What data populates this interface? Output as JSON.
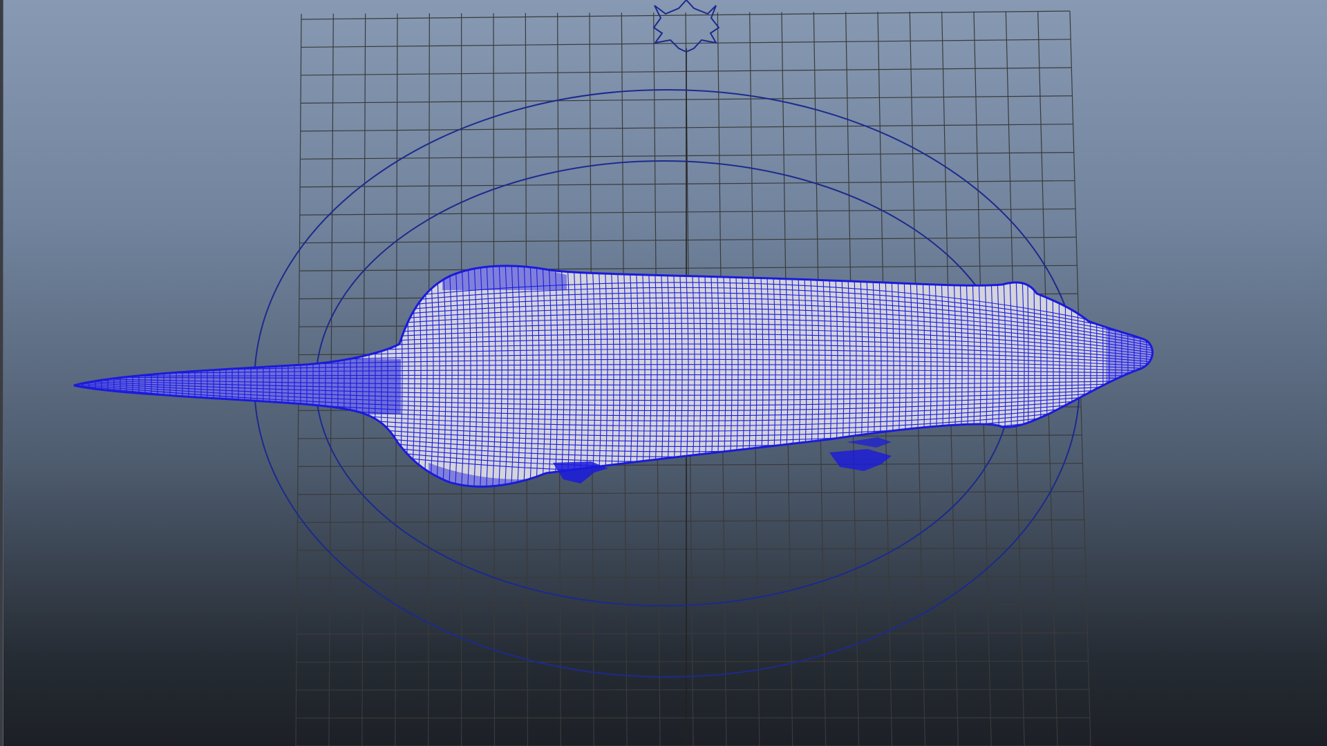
{
  "viewport": {
    "camera": "top",
    "shading": "wireframe",
    "grid": {
      "visible": true,
      "color": "#3a3a3a"
    },
    "background": {
      "top": "#8799b3",
      "bottom": "#1c2026"
    }
  },
  "scene": {
    "objects": [
      {
        "name": "rat-mesh",
        "type": "polygon-mesh",
        "wire_color": "#1a1adc",
        "selected": true
      },
      {
        "name": "inner-control-circle",
        "type": "nurbs-curve",
        "color": "#1c2a8c"
      },
      {
        "name": "outer-control-circle",
        "type": "nurbs-curve",
        "color": "#1c2a8c"
      },
      {
        "name": "pivot-star",
        "type": "nurbs-curve",
        "color": "#1c2a8c"
      }
    ]
  },
  "icons": {
    "pivot": "star-icon"
  }
}
